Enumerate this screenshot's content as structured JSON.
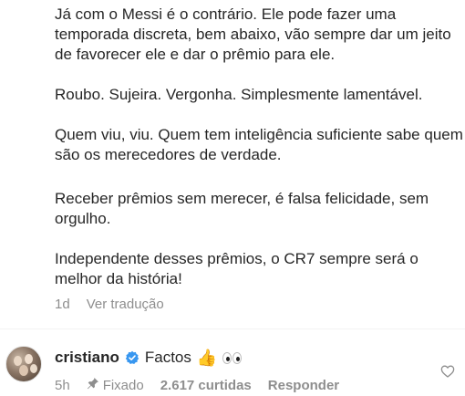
{
  "comment": {
    "paragraphs": [
      "Já com o Messi é o contrário. Ele pode fazer uma temporada discreta, bem abaixo, vão sempre dar um jeito de favorecer ele e dar o prêmio para ele.",
      "Roubo. Sujeira. Vergonha. Simplesmente lamentável.",
      "Quem viu, viu. Quem tem inteligência suficiente sabe quem são os merecedores de verdade.",
      "Receber prêmios sem merecer, é falsa felicidade, sem orgulho.",
      "Independente desses prêmios, o CR7 sempre será o melhor da história!"
    ],
    "time": "1d",
    "translate_label": "Ver tradução"
  },
  "reply": {
    "username": "cristiano",
    "verified_icon": "verified-badge-icon",
    "text": "Factos",
    "emoji_thumb": "👍",
    "emoji_eyes_icon": "eyes-icon",
    "time": "5h",
    "pinned_label": "Fixado",
    "likes_label": "2.617 curtidas",
    "reply_label": "Responder",
    "like_icon": "heart-icon"
  },
  "colors": {
    "text": "#262626",
    "muted": "#8e8e8e",
    "verified": "#3897f0"
  }
}
